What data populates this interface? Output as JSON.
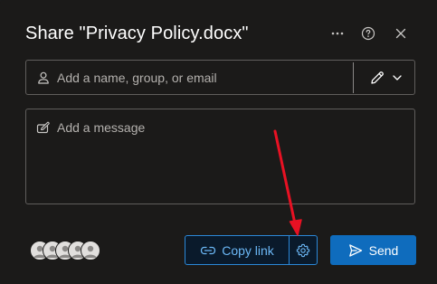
{
  "dialog": {
    "title": "Share \"Privacy Policy.docx\""
  },
  "header": {
    "more_icon": "more-horizontal-icon",
    "help_icon": "help-circle-icon",
    "close_icon": "close-icon"
  },
  "people": {
    "placeholder": "Add a name, group, or email",
    "value": "",
    "icon": "person-icon",
    "permission_icon": "pencil-icon"
  },
  "message": {
    "placeholder": "Add a message",
    "value": "",
    "icon": "compose-icon"
  },
  "footer": {
    "avatars_count": 5,
    "copy_link_label": "Copy link",
    "copy_link_icon": "link-icon",
    "link_settings_icon": "gear-icon",
    "send_label": "Send",
    "send_icon": "send-icon"
  },
  "colors": {
    "background": "#1b1a19",
    "accent": "#0f6cbd",
    "link_accent": "#6cb8f6",
    "annotation": "#e81123"
  }
}
